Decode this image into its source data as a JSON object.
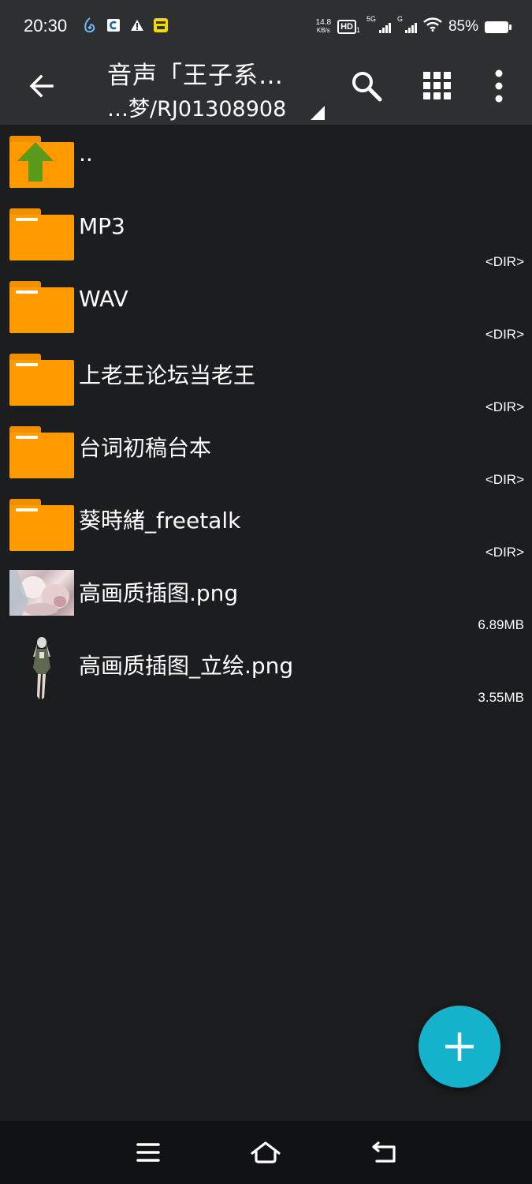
{
  "status_bar": {
    "time": "20:30",
    "net_speed_value": "14.8",
    "net_speed_unit": "KB/s",
    "hd_label": "HD",
    "hd_sub": "1",
    "sim1_label": "5G",
    "sim2_label": "G",
    "battery": "85%",
    "icons": [
      "app-notification-icon",
      "app-c-icon",
      "warning-icon",
      "app-yellow-icon",
      "hd-icon",
      "signal-5g-icon",
      "signal-g-icon",
      "wifi-icon",
      "battery-icon"
    ]
  },
  "app_bar": {
    "title": "音声「王子系…",
    "subtitle": "…梦/RJ01308908",
    "icons": [
      "back-arrow-icon",
      "search-icon",
      "grid-view-icon",
      "more-vert-icon"
    ]
  },
  "files": [
    {
      "name": "..",
      "meta": "",
      "type": "parent"
    },
    {
      "name": "MP3",
      "meta": "<DIR>",
      "type": "folder"
    },
    {
      "name": "WAV",
      "meta": "<DIR>",
      "type": "folder"
    },
    {
      "name": "上老王论坛当老王",
      "meta": "<DIR>",
      "type": "folder"
    },
    {
      "name": "台词初稿台本",
      "meta": "<DIR>",
      "type": "folder"
    },
    {
      "name": "葵時緒_freetalk",
      "meta": "<DIR>",
      "type": "folder"
    },
    {
      "name": "高画质插图.png",
      "meta": "6.89MB",
      "type": "image"
    },
    {
      "name": "高画质插图_立绘.png",
      "meta": "3.55MB",
      "type": "image"
    }
  ],
  "fab": {
    "icon": "plus-icon"
  },
  "nav_bar": {
    "icons": [
      "menu-icon",
      "home-icon",
      "back-icon"
    ]
  },
  "colors": {
    "bar_bg": "#2e2f31",
    "list_bg": "#1c1d1f",
    "folder": "#ff9a00",
    "fab": "#14b3cb",
    "up_arrow": "#5a9a1a"
  }
}
